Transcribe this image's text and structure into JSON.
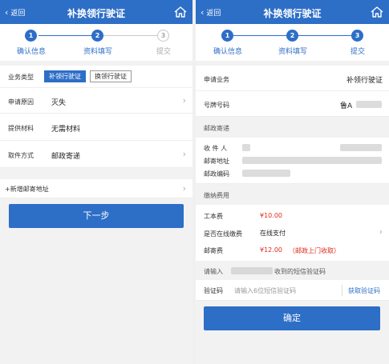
{
  "left": {
    "header": {
      "back": "返回",
      "title": "补换领行驶证"
    },
    "steps": [
      {
        "num": "1",
        "label": "确认信息"
      },
      {
        "num": "2",
        "label": "资料填写"
      },
      {
        "num": "3",
        "label": "提交"
      }
    ],
    "business_type": {
      "label": "业务类型",
      "options": [
        "补领行驶证",
        "换领行驶证"
      ],
      "selected": "补领行驶证"
    },
    "reason": {
      "label": "申请原因",
      "value": "灭失"
    },
    "materials": {
      "label": "提供材料",
      "value": "无需材料"
    },
    "pickup": {
      "label": "取件方式",
      "value": "邮政寄递"
    },
    "add_address": "+新增邮寄地址",
    "next_button": "下一步"
  },
  "right": {
    "header": {
      "back": "返回",
      "title": "补换领行驶证"
    },
    "steps": [
      {
        "num": "1",
        "label": "确认信息"
      },
      {
        "num": "2",
        "label": "资料填写"
      },
      {
        "num": "3",
        "label": "提交"
      }
    ],
    "apply_business": {
      "label": "申请业务",
      "value": "补领行驶证"
    },
    "plate": {
      "label": "号牌号码",
      "value": "鲁A"
    },
    "postal_section": "邮政寄递",
    "recipient": {
      "label": "收 件 人"
    },
    "address": {
      "label": "邮寄地址"
    },
    "postcode": {
      "label": "邮政编码"
    },
    "fee_section": "缴纳费用",
    "cost": {
      "label": "工本费",
      "value": "¥10.00"
    },
    "online_pay": {
      "label": "是否在线缴费",
      "value": "在线支付"
    },
    "postage": {
      "label": "邮寄费",
      "value": "¥12.00",
      "note": "（邮政上门收取）"
    },
    "sms_prompt_prefix": "请输入",
    "sms_prompt_suffix": "收到的短信验证码",
    "code": {
      "label": "验证码",
      "placeholder": "请输入6位短信验证码",
      "get_code": "获取验证码"
    },
    "confirm_button": "确定"
  },
  "colors": {
    "accent": "#2d6ec7",
    "price": "#e0291b",
    "background": "#f2f2f2"
  },
  "icons": {
    "home": "home-icon",
    "back": "chevron-left-icon",
    "arrow": "chevron-right-icon"
  }
}
